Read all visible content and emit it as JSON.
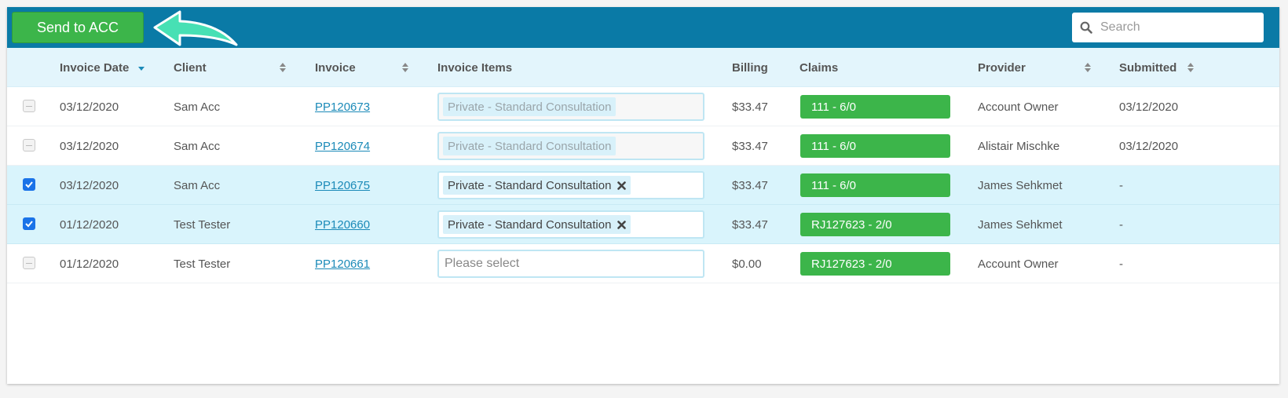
{
  "toolbar": {
    "send_label": "Send to ACC",
    "search_placeholder": "Search"
  },
  "colors": {
    "topbar": "#0a7aa6",
    "accent_green": "#3cb54a",
    "header_bg": "#e3f5fc",
    "selected_row_bg": "#d9f4fc",
    "arrow": "#47e0b4",
    "link": "#1b8ab8"
  },
  "icons": [
    "search-icon",
    "arrow-left-icon",
    "sort-icon",
    "sort-desc-icon",
    "remove-icon",
    "checkbox-icon"
  ],
  "columns": {
    "invoice_date": "Invoice Date",
    "client": "Client",
    "invoice": "Invoice",
    "invoice_items": "Invoice Items",
    "billing": "Billing",
    "claims": "Claims",
    "provider": "Provider",
    "submitted": "Submitted"
  },
  "rows": [
    {
      "checked": false,
      "disabled": true,
      "date": "03/12/2020",
      "client": "Sam Acc",
      "invoice": "PP120673",
      "item": "Private - Standard Consultation",
      "billing": "$33.47",
      "claim": "111 - 6/0",
      "provider": "Account Owner",
      "submitted": "03/12/2020"
    },
    {
      "checked": false,
      "disabled": true,
      "date": "03/12/2020",
      "client": "Sam Acc",
      "invoice": "PP120674",
      "item": "Private - Standard Consultation",
      "billing": "$33.47",
      "claim": "111 - 6/0",
      "provider": "Alistair Mischke",
      "submitted": "03/12/2020"
    },
    {
      "checked": true,
      "disabled": false,
      "date": "03/12/2020",
      "client": "Sam Acc",
      "invoice": "PP120675",
      "item": "Private - Standard Consultation",
      "billing": "$33.47",
      "claim": "111 - 6/0",
      "provider": "James Sehkmet",
      "submitted": "-"
    },
    {
      "checked": true,
      "disabled": false,
      "date": "01/12/2020",
      "client": "Test Tester",
      "invoice": "PP120660",
      "item": "Private - Standard Consultation",
      "billing": "$33.47",
      "claim": "RJ127623 - 2/0",
      "provider": "James Sehkmet",
      "submitted": "-"
    },
    {
      "checked": false,
      "disabled": false,
      "date": "01/12/2020",
      "client": "Test Tester",
      "invoice": "PP120661",
      "item": "",
      "item_placeholder": "Please select",
      "billing": "$0.00",
      "claim": "RJ127623 - 2/0",
      "provider": "Account Owner",
      "submitted": "-"
    }
  ]
}
